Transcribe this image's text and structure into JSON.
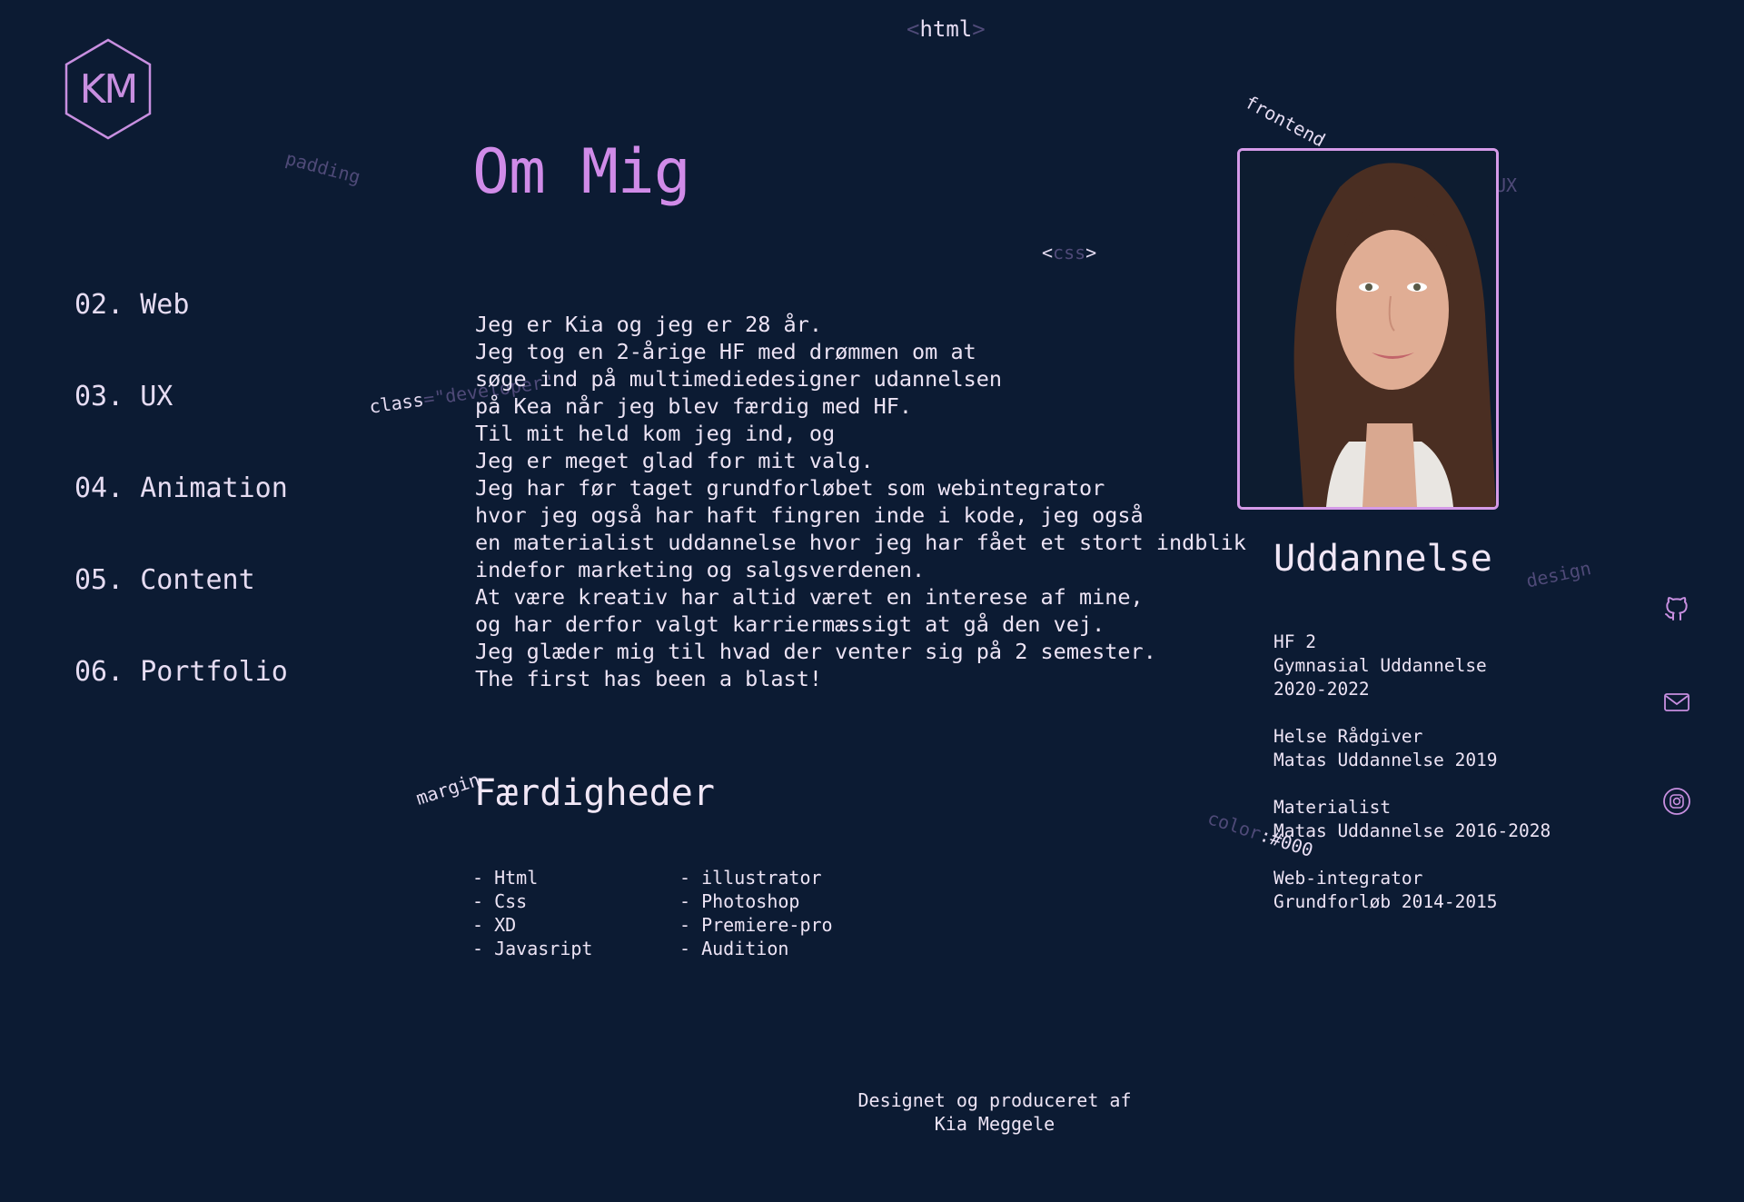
{
  "logo": {
    "text": "KM"
  },
  "floating": {
    "html_tag_open": "<",
    "html_tag_name": "html",
    "html_tag_close": ">",
    "frontend": "frontend",
    "padding": "padding",
    "css_open": "<",
    "css_name": "css",
    "css_close": ">",
    "ux": "UX",
    "class_name": "class",
    "class_value": "=\"developer\"",
    "design": "design",
    "margin": "margin",
    "color_name": "color",
    "color_value": ":#000"
  },
  "nav": {
    "items": [
      {
        "label": "02. Web"
      },
      {
        "label": "03. UX"
      },
      {
        "label": "04. Animation"
      },
      {
        "label": "05. Content"
      },
      {
        "label": "06. Portfolio"
      }
    ]
  },
  "main": {
    "title": "Om Mig",
    "bio": [
      "Jeg er Kia og jeg er 28 år.",
      "Jeg tog en 2-årige HF med drømmen om at",
      "søge ind på multimediedesigner udannelsen",
      "på Kea når jeg blev færdig med HF.",
      "Til mit held kom jeg ind, og",
      "Jeg er meget glad for mit valg.",
      "Jeg har før taget grundforløbet som webintegrator",
      "hvor jeg også har haft fingren inde i kode, jeg også",
      "en materialist uddannelse hvor jeg har fået et stort indblik",
      "indefor marketing og salgsverdenen.",
      "At være kreativ har altid været en interese af mine,",
      "og har derfor valgt karriermæssigt at gå den vej.",
      "Jeg glæder mig til hvad der venter sig på 2 semester.",
      "The first has been a blast!"
    ],
    "skills_title": "Færdigheder",
    "skills_col1": [
      "- Html",
      "- Css",
      "- XD",
      "- Javasript"
    ],
    "skills_col2": [
      "- illustrator",
      "- Photoshop",
      "- Premiere-pro",
      "- Audition"
    ]
  },
  "education": {
    "title": "Uddannelse",
    "entries": [
      [
        "HF 2",
        "Gymnasial Uddannelse",
        "2020-2022"
      ],
      [
        "Helse Rådgiver",
        "Matas Uddannelse 2019"
      ],
      [
        "Materialist",
        "Matas Uddannelse 2016-2028"
      ],
      [
        "Web-integrator",
        "Grundforløb 2014-2015"
      ]
    ]
  },
  "social": [
    "github-icon",
    "mail-icon",
    "instagram-icon"
  ],
  "footer": {
    "line1": "Designet og produceret af",
    "line2": "Kia Meggele"
  },
  "colors": {
    "background": "#0c1b33",
    "accent": "#d08be8",
    "text": "#ede4f5"
  }
}
